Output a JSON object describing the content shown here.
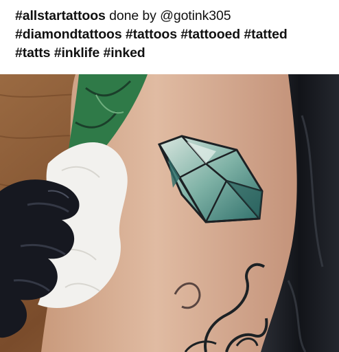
{
  "caption": {
    "line1": {
      "tag": "#allstartattoos",
      "text": " done by @gotink305"
    },
    "line2": "#diamondtattoos #tattoos #tattooed #tatted",
    "line3": "#tatts #inklife #inked"
  },
  "photo": {
    "subject": "diamond tattoo on arm",
    "colors": {
      "skin": "#d7b096",
      "wood": "#8a5a35",
      "glove": "#161820",
      "jacket": "#1a1c22",
      "tissue": "#f2f1ee",
      "ink_teal": "#2f6f6a",
      "ink_green": "#2f7a48",
      "ink_dark": "#1c2124"
    }
  }
}
